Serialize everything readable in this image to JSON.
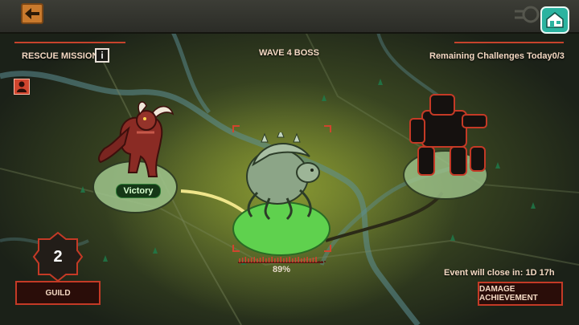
{
  "header": {
    "mission_title": "RESCUE MISSION",
    "info_icon": "i",
    "wave_title": "WAVE 4 BOSS",
    "remaining_label": "Remaining Challenges Today0/3"
  },
  "nodes": [
    {
      "name": "red-demon-boss",
      "status": "Victory"
    },
    {
      "name": "insect-boss",
      "status": "current",
      "hp_text": "89%",
      "hp_fraction": 0.89
    },
    {
      "name": "mech-boss",
      "status": "locked"
    }
  ],
  "guild": {
    "count": "2",
    "label": "GUILD"
  },
  "event": {
    "close_text": "Event will close in: 1D 17h"
  },
  "damage_button": {
    "label": "DAMAGE ACHIEVEMENT"
  },
  "icons": {
    "back": "back-arrow-icon",
    "home": "home-icon",
    "info": "info-icon",
    "profile": "profile-icon"
  },
  "colors": {
    "accent_red": "#c43a26",
    "back_orange": "#c97a2d",
    "home_teal": "#2bb3a0",
    "active_green": "#6fcf5f"
  }
}
